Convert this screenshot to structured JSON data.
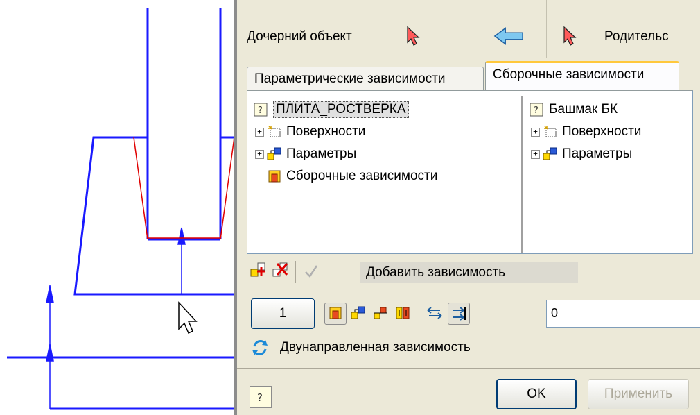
{
  "dialog": {
    "child_label": "Дочерний объект",
    "parent_label": "Родительс",
    "tabs": [
      "Параметрические зависимости",
      "Сборочные зависимости"
    ],
    "child_tree": {
      "root": "ПЛИТА_РОСТВЕРКА",
      "items": [
        "Поверхности",
        "Параметры",
        "Сборочные зависимости"
      ]
    },
    "parent_tree": {
      "root": "Башмак БК",
      "items": [
        "Поверхности",
        "Параметры"
      ]
    },
    "add_dependency_label": "Добавить зависимость",
    "count_button": "1",
    "value_input": "0",
    "bidirectional_label": "Двунаправленная зависимость",
    "ok_label": "OK",
    "apply_label": "Применить"
  },
  "colors": {
    "drawing_line": "#1a1aff",
    "constraint_line": "#e00000",
    "dialog_bg": "#ece9d8",
    "tab_accent": "#ffc83c"
  }
}
